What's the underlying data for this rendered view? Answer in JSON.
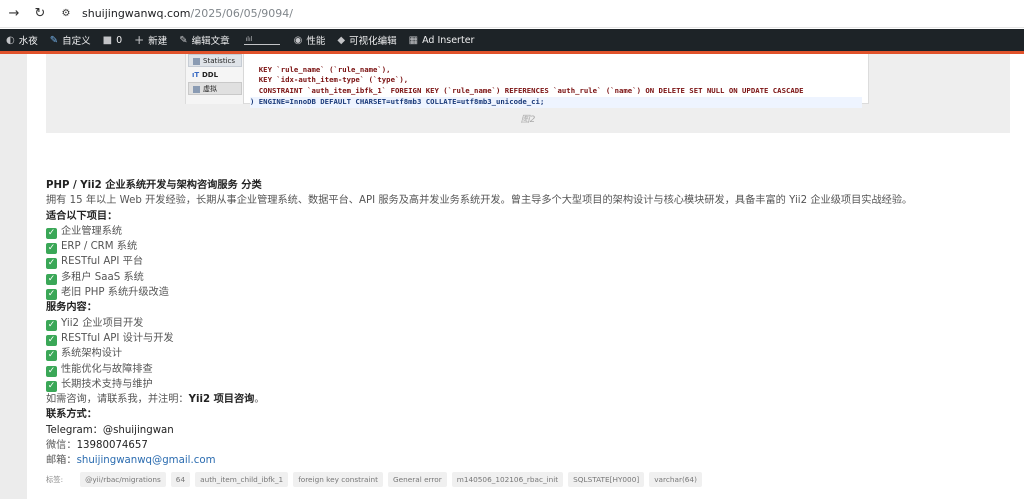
{
  "browser": {
    "url_host": "shuijingwanwq.com",
    "url_path": "/2025/06/05/9094/"
  },
  "adminbar": {
    "items": [
      "水夜",
      "自定义",
      "0",
      "新建",
      "编辑文章",
      "性能",
      "可视化编辑",
      "Ad Inserter"
    ]
  },
  "figure": {
    "side_tabs": [
      "Statistics",
      "DDL",
      "虚拟"
    ],
    "code": [
      "  KEY `rule_name` (`rule_name`),",
      "  KEY `idx-auth_item-type` (`type`),",
      "  CONSTRAINT `auth_item_ibfk_1` FOREIGN KEY (`rule_name`) REFERENCES `auth_rule` (`name`) ON DELETE SET NULL ON UPDATE CASCADE",
      ") ENGINE=InnoDB DEFAULT CHARSET=utf8mb3 COLLATE=utf8mb3_unicode_ci;"
    ],
    "caption": "图2"
  },
  "content": {
    "heading": "PHP / Yii2 企业系统开发与架构咨询服务 分类",
    "intro": "拥有 15 年以上 Web 开发经验，长期从事企业管理系统、数据平台、API 服务及高并发业务系统开发。曾主导多个大型项目的架构设计与核心模块研发，具备丰富的 Yii2 企业级项目实战经验。",
    "suitable_label": "适合以下项目：",
    "suitable": [
      "企业管理系统",
      "ERP / CRM 系统",
      "RESTful API 平台",
      "多租户 SaaS 系统",
      "老旧 PHP 系统升级改造"
    ],
    "services_label": "服务内容：",
    "services": [
      "Yii2 企业项目开发",
      "RESTful API 设计与开发",
      "系统架构设计",
      "性能优化与故障排查",
      "长期技术支持与维护"
    ],
    "consult_prefix": "如需咨询，请联系我，并注明：",
    "consult_bold": "Yii2 项目咨询",
    "consult_suffix": "。",
    "contact_label": "联系方式：",
    "telegram_label": "Telegram：",
    "telegram": "@shuijingwan",
    "wechat_label": "微信：",
    "wechat": "13980074657",
    "email_label": "邮箱：",
    "email": "shuijingwanwq@gmail.com"
  },
  "tags": {
    "label": "标签:",
    "items": [
      "@yii/rbac/migrations",
      "64",
      "auth_item_child_ibfk_1",
      "foreign key constraint",
      "General error",
      "m140506_102106_rbac_init",
      "SQLSTATE[HY000]",
      "varchar(64)"
    ]
  },
  "colors": {
    "adminbar": "#1d2327",
    "accent": "#e0522b",
    "check": "#3aa757",
    "link": "#2b6cb0"
  }
}
